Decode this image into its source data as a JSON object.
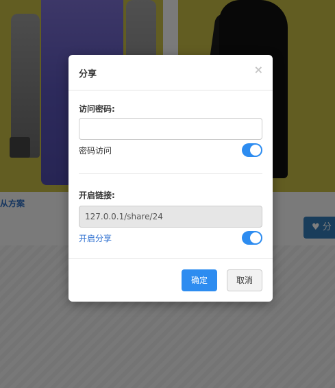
{
  "background": {
    "plan_label": "从方案",
    "share_button_label": "分"
  },
  "modal": {
    "title": "分享",
    "close_glyph": "×",
    "password_section": {
      "label": "访问密码:",
      "input_value": "",
      "toggle_label": "密码访问",
      "toggle_on": true
    },
    "link_section": {
      "label": "开启链接:",
      "link_value": "127.0.0.1/share/24",
      "toggle_label": "开启分享",
      "toggle_on": true
    },
    "buttons": {
      "confirm": "确定",
      "cancel": "取消"
    }
  },
  "colors": {
    "accent": "#2d8cf0",
    "link_text": "#2d6fd0",
    "product_bg": "#c4bb44"
  },
  "icons": {
    "share_bg": "heart-icon",
    "close": "close-icon"
  }
}
